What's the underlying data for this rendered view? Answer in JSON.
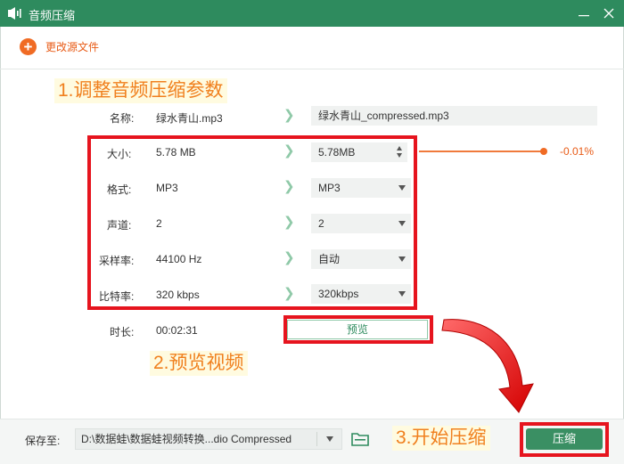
{
  "window": {
    "title": "音频压缩"
  },
  "toolbar": {
    "change_source_label": "更改源文件"
  },
  "annotations": {
    "step1": "1.调整音频压缩参数",
    "step2": "2.预览视频",
    "step3": "3.开始压缩"
  },
  "file": {
    "name_label": "名称:",
    "source_name": "绿水青山.mp3",
    "output_name": "绿水青山_compressed.mp3"
  },
  "params": [
    {
      "label": "大小:",
      "source": "5.78 MB",
      "target": "5.78MB",
      "control": "spinner"
    },
    {
      "label": "格式:",
      "source": "MP3",
      "target": "MP3",
      "control": "dropdown"
    },
    {
      "label": "声道:",
      "source": "2",
      "target": "2",
      "control": "dropdown"
    },
    {
      "label": "采样率:",
      "source": "44100 Hz",
      "target": "自动",
      "control": "dropdown"
    },
    {
      "label": "比特率:",
      "source": "320 kbps",
      "target": "320kbps",
      "control": "dropdown"
    }
  ],
  "size_change": {
    "percent": "-0.01%"
  },
  "duration": {
    "label": "时长:",
    "value": "00:02:31"
  },
  "preview_button": "预览",
  "save": {
    "label": "保存至:",
    "path": "D:\\数据蛙\\数据蛙视频转换...dio Compressed"
  },
  "compress_button": "压缩",
  "colors": {
    "brand_green": "#2e8b5e",
    "accent_orange": "#f06b24",
    "annotation_red": "#e6141e",
    "annotation_text": "#f0801e"
  }
}
